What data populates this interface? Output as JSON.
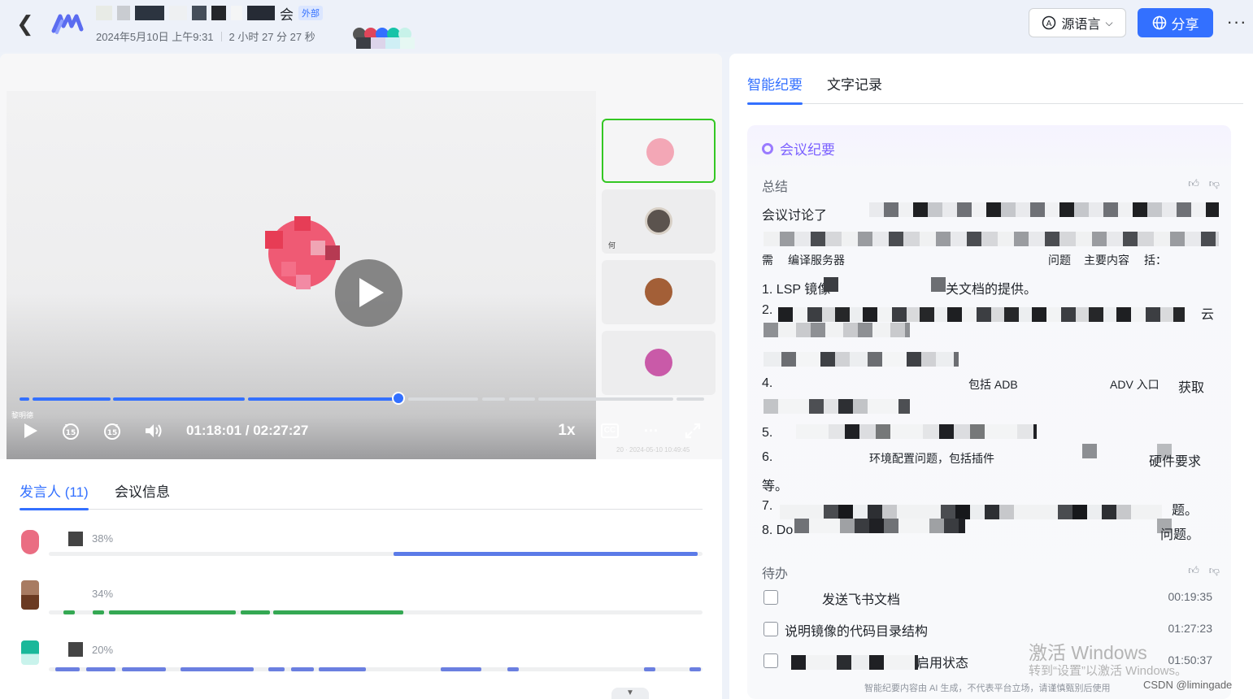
{
  "header": {
    "title_suffix": "会",
    "external_badge": "外部",
    "date": "2024年5月10日 上午9:31",
    "duration": "2 小时 27 分 27 秒",
    "language_button": "源语言",
    "share_button": "分享",
    "more_label": "···"
  },
  "player": {
    "speaker_tag": "黎明德",
    "time_display": "01:18:01 / 02:27:27",
    "progress_fraction": 0.53,
    "speed_label": "1x",
    "cc_label": "CC",
    "more_label": "···",
    "watermark": "20 · 2024-05-10 10:49:45",
    "thumb_label": "何"
  },
  "speaker_tabs": {
    "speakers_tab": "发言人 (11)",
    "meeting_info_tab": "会议信息"
  },
  "speakers": [
    {
      "percent": "38%",
      "color": "#5b7be8"
    },
    {
      "percent": "34%",
      "color": "#34a853"
    },
    {
      "percent": "20%",
      "color": "#6b7fe0"
    }
  ],
  "right_tabs": {
    "summary_tab": "智能纪要",
    "transcript_tab": "文字记录"
  },
  "summary": {
    "card_title": "会议纪要",
    "overview_label": "总结",
    "todo_label": "待办",
    "lines": [
      "会议讨论了",
      "需",
      "编译服务器",
      "问题",
      "主要内容",
      "括：",
      "1. LSP 镜像",
      "关文档的提供。",
      "2.",
      "云",
      "4.",
      "包括 ADB",
      "ADV 入口",
      "获取",
      "5.",
      "6.",
      "环境配置问题，包括插件",
      "硬件要求",
      "等。",
      "7.",
      "题。",
      "8. Do",
      "问题。"
    ],
    "todos": [
      {
        "text": "发送飞书文档",
        "time": "00:19:35"
      },
      {
        "text": "说明镜像的代码目录结构",
        "time": "01:27:23"
      },
      {
        "text": "启用状态",
        "time": "01:50:37"
      }
    ],
    "footer_note": "智能纪要内容由 AI 生成，不代表平台立场，请谨慎甄别后使用"
  },
  "overlay": {
    "windows_line1": "激活 Windows",
    "windows_line2": "转到“设置”以激活 Windows。",
    "csdn": "CSDN @limingade"
  },
  "colors": {
    "accent": "#3370ff",
    "summary_purple": "#7b61ff",
    "thumb_active_border": "#34c724"
  },
  "icons": {
    "back": "chevron-left-icon",
    "language": "translate-icon",
    "share": "globe-icon",
    "play": "play-icon",
    "rewind": "rewind-15-icon",
    "forward": "forward-15-icon",
    "volume": "volume-icon",
    "fullscreen": "fullscreen-icon",
    "like": "thumbs-up-icon",
    "dislike": "thumbs-down-icon"
  }
}
